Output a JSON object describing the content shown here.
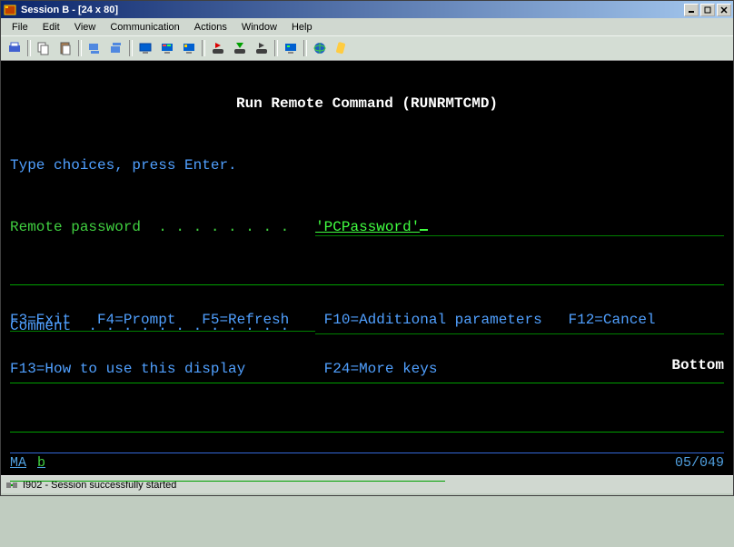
{
  "titlebar": {
    "text": "Session B - [24 x 80]"
  },
  "menu": {
    "file": "File",
    "edit": "Edit",
    "view": "View",
    "communication": "Communication",
    "actions": "Actions",
    "window": "Window",
    "help": "Help"
  },
  "terminal": {
    "title": "Run Remote Command (RUNRMTCMD)",
    "instruction": "Type choices, press Enter.",
    "remote_password_label": "Remote password  . . . . . . . .   ",
    "remote_password_value": "'PCPassword'",
    "comment_label": "Comment  . . . . . . . . . . . .   ",
    "comment_value": "",
    "bottom": "Bottom",
    "fkeys_line1": "F3=Exit   F4=Prompt   F5=Refresh    F10=Additional parameters   F12=Cancel",
    "fkeys_line2": "F13=How to use this display         F24=More keys",
    "oia_left_ma": "MA",
    "oia_left_b": "b",
    "oia_right": "05/049"
  },
  "statusbar": {
    "text": "I902 - Session successfully started"
  }
}
